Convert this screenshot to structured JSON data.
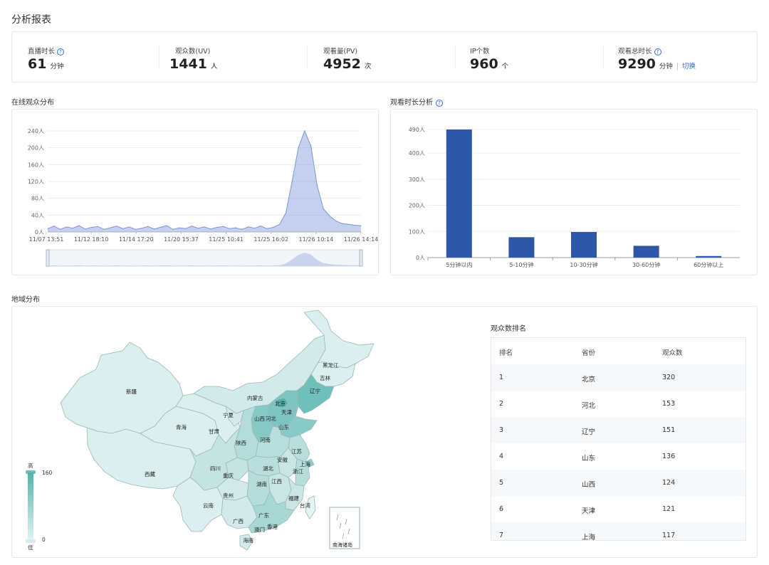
{
  "page": {
    "title": "分析报表"
  },
  "stats": [
    {
      "label": "直播时长",
      "value": "61",
      "unit": "分钟",
      "help": "?"
    },
    {
      "label": "观众数(UV)",
      "value": "1441",
      "unit": "人"
    },
    {
      "label": "观看量(PV)",
      "value": "4952",
      "unit": "次"
    },
    {
      "label": "IP个数",
      "value": "960",
      "unit": "个"
    },
    {
      "label": "观看总时长",
      "value": "9290",
      "unit": "分钟",
      "help": "?",
      "action": "切换"
    }
  ],
  "online": {
    "title": "在线观众分布"
  },
  "duration": {
    "title": "观看时长分析",
    "help": "?"
  },
  "region": {
    "title": "地域分布",
    "legend": {
      "high": "高",
      "low": "低",
      "max": "160",
      "min": "0"
    },
    "inset_label": "南海诸岛",
    "colors": {
      "low": "#e4f3f3",
      "high": "#4fb3ad"
    }
  },
  "ranking": {
    "title": "观众数排名",
    "headers": [
      "排名",
      "省份",
      "观众数"
    ],
    "rows": [
      [
        "1",
        "北京",
        "320"
      ],
      [
        "2",
        "河北",
        "153"
      ],
      [
        "3",
        "辽宁",
        "151"
      ],
      [
        "4",
        "山东",
        "136"
      ],
      [
        "5",
        "山西",
        "124"
      ],
      [
        "6",
        "天津",
        "121"
      ],
      [
        "7",
        "上海",
        "117"
      ]
    ]
  },
  "chart_data": [
    {
      "type": "area",
      "color": "#7d97d6",
      "y_tick_labels": [
        "0人",
        "40人",
        "80人",
        "120人",
        "160人",
        "200人",
        "240人"
      ],
      "ylim": [
        0,
        240
      ],
      "x_tick_labels": [
        "11/07 13:51",
        "11/12 18:10",
        "11/14 17:20",
        "11/20 15:37",
        "11/25 10:41",
        "11/25 16:02",
        "11/26 10:14",
        "11/26 14:14"
      ],
      "x": [
        0,
        2,
        4,
        6,
        8,
        10,
        12,
        14,
        16,
        18,
        20,
        22,
        24,
        26,
        28,
        30,
        32,
        34,
        36,
        38,
        40,
        42,
        44,
        46,
        48,
        50,
        52,
        54,
        56,
        58,
        60,
        62,
        64,
        66,
        68,
        70,
        72,
        74,
        76,
        78,
        80,
        82,
        84,
        86,
        88,
        90,
        92,
        94,
        96,
        98,
        100
      ],
      "values": [
        8,
        14,
        6,
        12,
        9,
        15,
        7,
        11,
        13,
        6,
        10,
        14,
        8,
        12,
        6,
        9,
        13,
        7,
        11,
        15,
        6,
        10,
        8,
        14,
        9,
        12,
        7,
        11,
        13,
        8,
        10,
        6,
        12,
        9,
        14,
        8,
        11,
        18,
        45,
        120,
        200,
        240,
        205,
        110,
        55,
        38,
        26,
        20,
        18,
        16,
        15
      ],
      "grid": true
    },
    {
      "type": "bar",
      "color": "#2d56a8",
      "categories": [
        "5分钟以内",
        "5-10分钟",
        "10-30分钟",
        "30-60分钟",
        "60分钟以上"
      ],
      "values": [
        490,
        78,
        98,
        45,
        6
      ],
      "y_tick_labels": [
        "0人",
        "100人",
        "200人",
        "300人",
        "400人",
        "490人"
      ],
      "ylim": [
        0,
        490
      ],
      "grid": true
    }
  ],
  "map_labels": [
    "新疆",
    "西藏",
    "青海",
    "甘肃",
    "宁夏",
    "内蒙古",
    "黑龙江",
    "吉林",
    "辽宁",
    "北京",
    "天津",
    "河北",
    "山西",
    "山东",
    "陕西",
    "河南",
    "四川",
    "重庆",
    "湖北",
    "安徽",
    "江苏",
    "上海",
    "浙江",
    "贵州",
    "湖南",
    "江西",
    "福建",
    "台湾",
    "云南",
    "广西",
    "广东",
    "澳门",
    "香港",
    "海南"
  ]
}
